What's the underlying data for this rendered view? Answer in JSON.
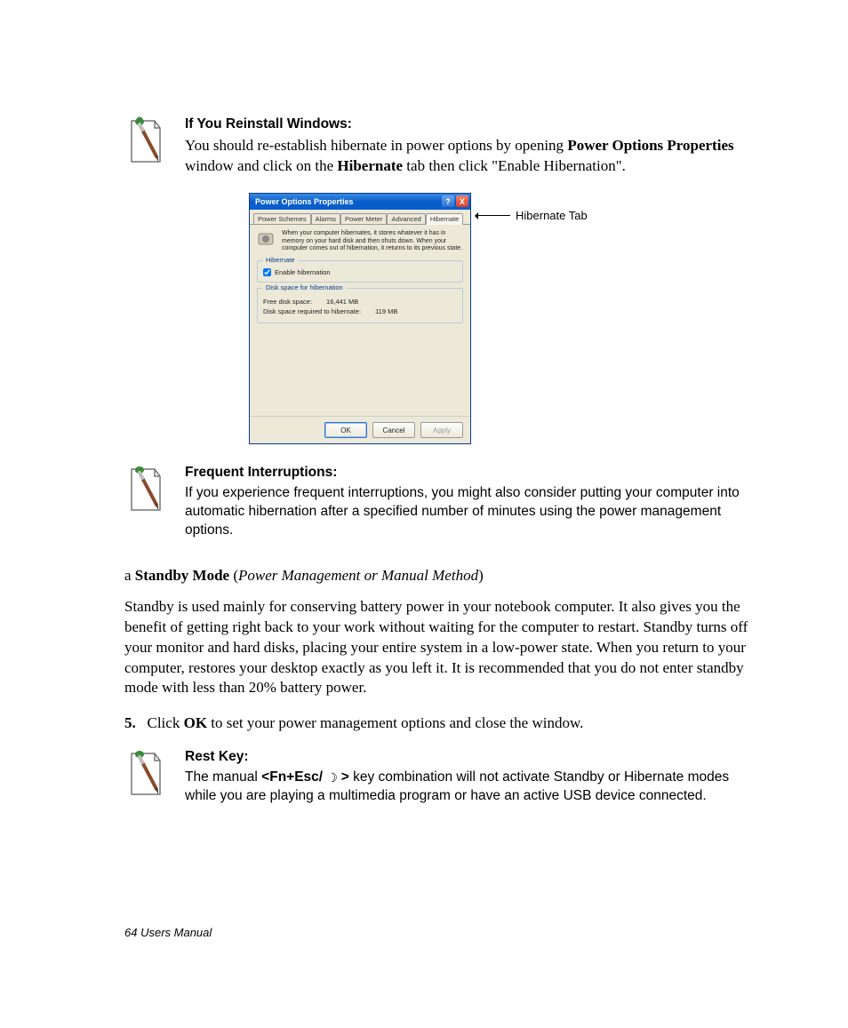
{
  "note1": {
    "title": "If You Reinstall Windows:",
    "line1_a": "You should re-establish hibernate in power options by opening ",
    "line1_b": "Power Options Properties",
    "line1_c": " window and click on the ",
    "line1_d": "Hibernate",
    "line1_e": " tab then click \"Enable Hibernation\"."
  },
  "dialog": {
    "title": "Power Options Properties",
    "help_label": "?",
    "close_label": "X",
    "tabs": [
      "Power Schemes",
      "Alarms",
      "Power Meter",
      "Advanced",
      "Hibernate"
    ],
    "active_tab": "Hibernate",
    "info_text": "When your computer hibernates, it stores whatever it has in memory on your hard disk and then shuts down. When your computer comes out of hibernation, it returns to its previous state.",
    "fs1_legend": "Hibernate",
    "enable_label": "Enable hibernation",
    "fs2_legend": "Disk space for hibernation",
    "free_label": "Free disk space:",
    "free_value": "16,441 MB",
    "required_label": "Disk space required to hibernate:",
    "required_value": "119 MB",
    "ok": "OK",
    "cancel": "Cancel",
    "apply": "Apply"
  },
  "callout_label": "Hibernate Tab",
  "note2": {
    "title": "Frequent Interruptions:",
    "body": "If you experience frequent interruptions, you might also consider putting your computer into automatic hibernation after a specified number of minutes using the power management options."
  },
  "standby": {
    "prefix": "a ",
    "bold": "Standby Mode",
    "paren_open": " (",
    "italic": "Power Management or Manual Method",
    "paren_close": ")",
    "body": "Standby is used mainly for conserving battery power in your notebook computer. It also gives you the benefit of getting right back to your work without waiting for the computer to restart. Standby turns off your monitor and hard disks, placing your entire system in a low-power state. When you return to your computer, restores your desktop exactly as you left it. It is recommended that you do not enter standby mode with less than 20% battery power."
  },
  "step5": {
    "num": "5.",
    "a": "Click ",
    "b": "OK",
    "c": " to set your power management options and close the window."
  },
  "note3": {
    "title": "Rest Key:",
    "a": "The manual ",
    "b": "<Fn+Esc/ ",
    "c": " >",
    "d": " key combination will not activate Standby or Hibernate modes while you are playing a multimedia program or have an active USB device connected."
  },
  "footer": "64  Users Manual"
}
